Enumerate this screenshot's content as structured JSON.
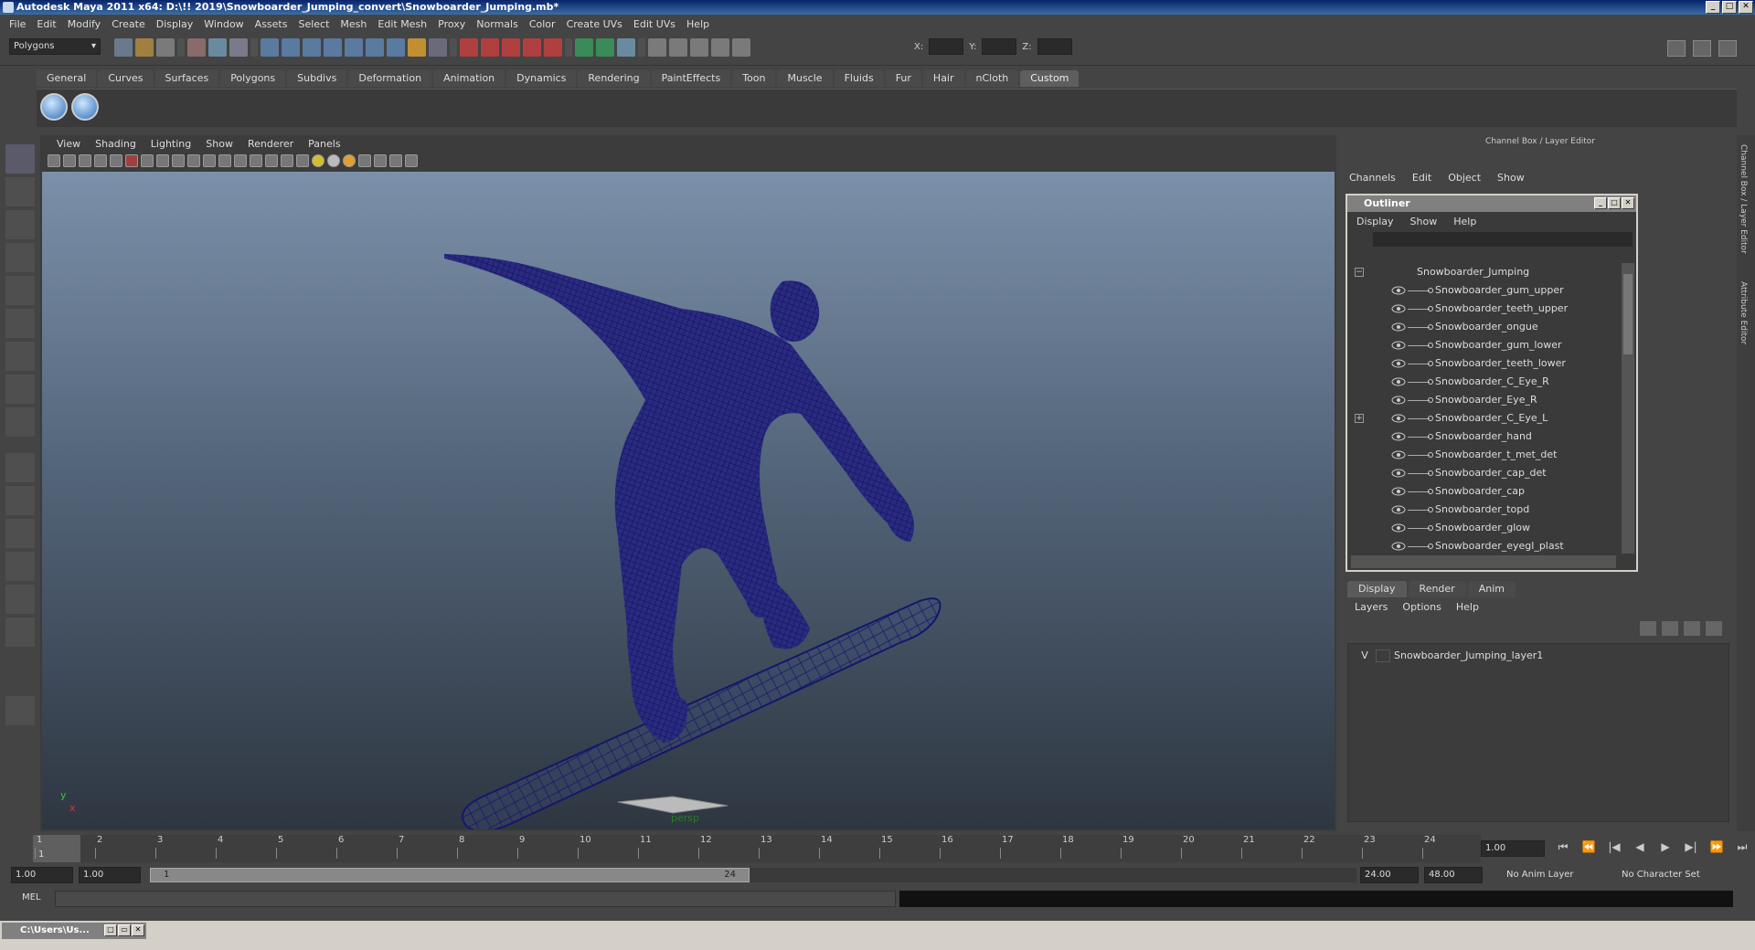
{
  "window": {
    "title": "Autodesk Maya 2011 x64: D:\\!! 2019\\Snowboarder_Jumping_convert\\Snowboarder_Jumping.mb*",
    "minimize": "_",
    "maximize": "□",
    "close": "✕"
  },
  "menubar": [
    "File",
    "Edit",
    "Modify",
    "Create",
    "Display",
    "Window",
    "Assets",
    "Select",
    "Mesh",
    "Edit Mesh",
    "Proxy",
    "Normals",
    "Color",
    "Create UVs",
    "Edit UVs",
    "Help"
  ],
  "statusline": {
    "mode": "Polygons",
    "x_label": "X:",
    "y_label": "Y:",
    "z_label": "Z:"
  },
  "shelf": {
    "tabs": [
      "General",
      "Curves",
      "Surfaces",
      "Polygons",
      "Subdivs",
      "Deformation",
      "Animation",
      "Dynamics",
      "Rendering",
      "PaintEffects",
      "Toon",
      "Muscle",
      "Fluids",
      "Fur",
      "Hair",
      "nCloth",
      "Custom"
    ],
    "active_tab": "Custom"
  },
  "viewport": {
    "menu": [
      "View",
      "Shading",
      "Lighting",
      "Show",
      "Renderer",
      "Panels"
    ],
    "camera": "persp",
    "axis_y": "y",
    "axis_x": "x"
  },
  "channelbox": {
    "header": "Channel Box / Layer Editor",
    "menu": [
      "Channels",
      "Edit",
      "Object",
      "Show"
    ]
  },
  "outliner": {
    "title": "Outliner",
    "menu": [
      "Display",
      "Show",
      "Help"
    ],
    "root": "Snowboarder_Jumping",
    "items": [
      "Snowboarder_gum_upper",
      "Snowboarder_teeth_upper",
      "Snowboarder_ongue",
      "Snowboarder_gum_lower",
      "Snowboarder_teeth_lower",
      "Snowboarder_C_Eye_R",
      "Snowboarder_Eye_R",
      "Snowboarder_C_Eye_L",
      "Snowboarder_hand",
      "Snowboarder_t_met_det",
      "Snowboarder_cap_det",
      "Snowboarder_cap",
      "Snowboarder_topd",
      "Snowboarder_glow",
      "Snowboarder_eyegl_plast"
    ]
  },
  "layers": {
    "tabs": [
      "Display",
      "Render",
      "Anim"
    ],
    "active_tab": "Display",
    "menu": [
      "Layers",
      "Options",
      "Help"
    ],
    "rows": [
      {
        "visible": "V",
        "name": "Snowboarder_Jumping_layer1"
      }
    ]
  },
  "timeline": {
    "ticks": [
      "1",
      "2",
      "3",
      "4",
      "5",
      "6",
      "7",
      "8",
      "9",
      "10",
      "11",
      "12",
      "13",
      "14",
      "15",
      "16",
      "17",
      "18",
      "19",
      "20",
      "21",
      "22",
      "23",
      "24"
    ],
    "current_frame_label": "1",
    "current_time": "1.00",
    "play_controls": [
      "⏮",
      "⏪",
      "|◀",
      "◀",
      "▶",
      "▶|",
      "⏩",
      "⏭"
    ]
  },
  "range": {
    "start": "1.00",
    "playback_start": "1.00",
    "slider_start": "1",
    "slider_end": "24",
    "playback_end": "24.00",
    "end": "48.00",
    "anim_layer": "No Anim Layer",
    "character_set": "No Character Set"
  },
  "command": {
    "label": "MEL"
  },
  "taskbar": {
    "item": "C:\\Users\\Us..."
  },
  "colors": {
    "wireframe": "#1c1c78",
    "viewport_top": "#7b90a9",
    "viewport_bottom": "#2e3641",
    "titlebar": "#0a246a"
  }
}
